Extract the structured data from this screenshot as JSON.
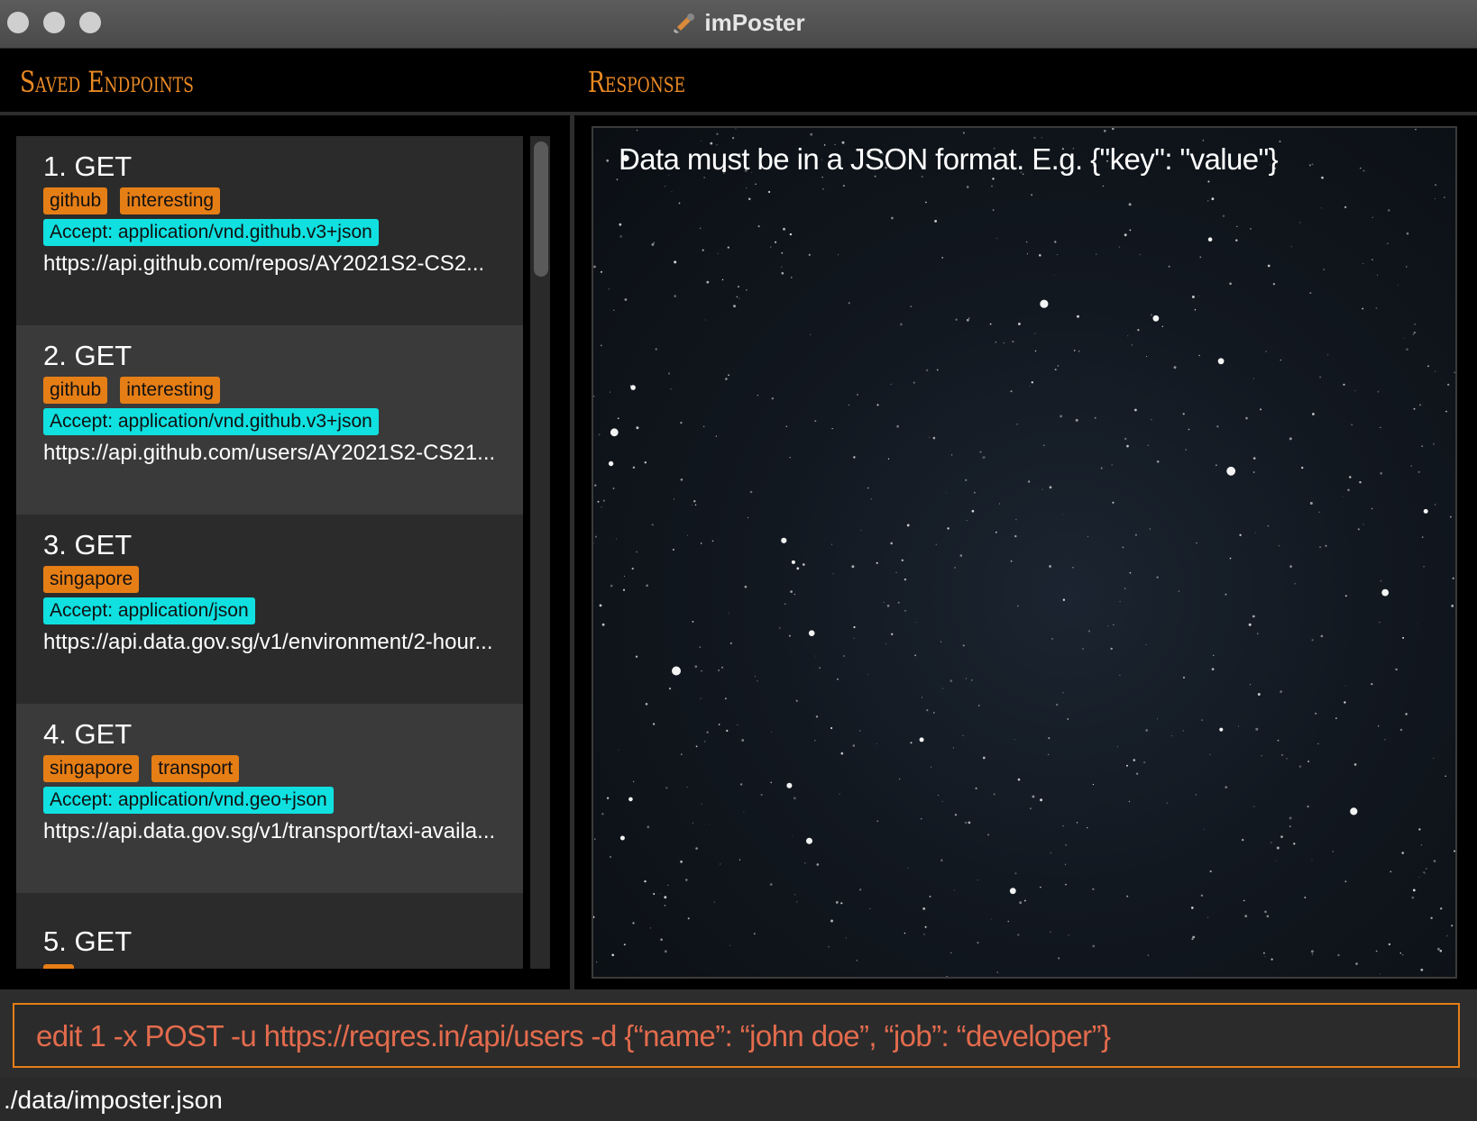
{
  "window": {
    "title": "imPoster"
  },
  "sections": {
    "endpoints_title": "Saved Endpoints",
    "response_title": "Response"
  },
  "endpoints": [
    {
      "title": "1.  GET",
      "tags": [
        "github",
        "interesting"
      ],
      "header": "Accept: application/vnd.github.v3+json",
      "url": "https://api.github.com/repos/AY2021S2-CS2..."
    },
    {
      "title": "2.  GET",
      "tags": [
        "github",
        "interesting"
      ],
      "header": "Accept: application/vnd.github.v3+json",
      "url": "https://api.github.com/users/AY2021S2-CS21..."
    },
    {
      "title": "3.  GET",
      "tags": [
        "singapore"
      ],
      "header": "Accept: application/json",
      "url": "https://api.data.gov.sg/v1/environment/2-hour..."
    },
    {
      "title": "4.  GET",
      "tags": [
        "singapore",
        "transport"
      ],
      "header": "Accept: application/vnd.geo+json",
      "url": "https://api.data.gov.sg/v1/transport/taxi-availa..."
    },
    {
      "title": "5.  GET"
    }
  ],
  "response": {
    "text": "Data must be in a JSON format. E.g. {\"key\": \"value\"}"
  },
  "command": {
    "value": "edit 1 -x POST -u https://reqres.in/api/users -d {“name”: “john doe”, “job”: “developer”}"
  },
  "status": {
    "path": "./data/imposter.json"
  },
  "colors": {
    "accent": "#e67e16",
    "header_tag": "#10e0e0",
    "command_text": "#e36b4d",
    "section_title": "#ea8a24"
  },
  "icons": {
    "app": "imposter-logo-icon"
  }
}
